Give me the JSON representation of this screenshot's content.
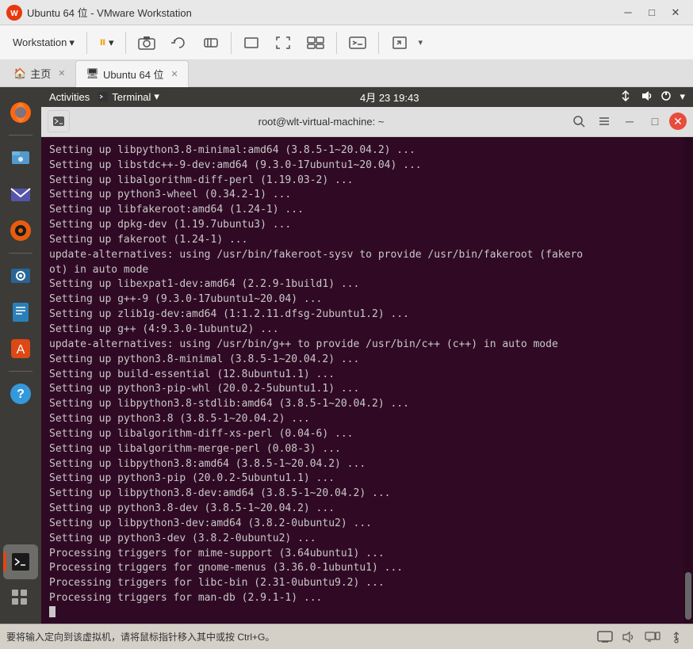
{
  "window": {
    "title": "Ubuntu 64 位 - VMware Workstation",
    "icon": "W"
  },
  "titlebar": {
    "minimize": "─",
    "restore": "□",
    "close": "✕"
  },
  "toolbar": {
    "workstation_label": "Workstation",
    "dropdown_arrow": "▾",
    "buttons": [
      {
        "name": "pause",
        "icon": "⏸",
        "has_dropdown": true
      },
      {
        "name": "snapshot",
        "icon": "📷"
      },
      {
        "name": "revert",
        "icon": "↺"
      },
      {
        "name": "suspend",
        "icon": "💤"
      },
      {
        "name": "power",
        "icon": "⏻"
      }
    ]
  },
  "tabs": [
    {
      "id": "home",
      "icon": "🏠",
      "label": "主页",
      "closable": true
    },
    {
      "id": "ubuntu",
      "icon": "🖥",
      "label": "Ubuntu 64 位",
      "closable": true,
      "active": true
    }
  ],
  "gnome_topbar": {
    "activities": "Activities",
    "app_name": "Terminal",
    "app_dropdown": "▾",
    "datetime": "4月 23  19:43",
    "net_icon": "⇅",
    "sound_icon": "🔊",
    "power_icon": "⏻",
    "dropdown": "▾"
  },
  "terminal": {
    "title": "root@wlt-virtual-machine: ~",
    "search_icon": "🔍",
    "menu_icon": "☰",
    "min_icon": "─",
    "restore_icon": "□",
    "close_icon": "✕",
    "content": [
      "Setting up libpython3.8-minimal:amd64 (3.8.5-1~20.04.2) ...",
      "Setting up libstdc++-9-dev:amd64 (9.3.0-17ubuntu1~20.04) ...",
      "Setting up libalgorithm-diff-perl (1.19.03-2) ...",
      "Setting up python3-wheel (0.34.2-1) ...",
      "Setting up libfakeroot:amd64 (1.24-1) ...",
      "Setting up dpkg-dev (1.19.7ubuntu3) ...",
      "Setting up fakeroot (1.24-1) ...",
      "update-alternatives: using /usr/bin/fakeroot-sysv to provide /usr/bin/fakeroot (fakero",
      "ot) in auto mode",
      "Setting up libexpat1-dev:amd64 (2.2.9-1build1) ...",
      "Setting up g++-9 (9.3.0-17ubuntu1~20.04) ...",
      "Setting up zlib1g-dev:amd64 (1:1.2.11.dfsg-2ubuntu1.2) ...",
      "Setting up g++ (4:9.3.0-1ubuntu2) ...",
      "update-alternatives: using /usr/bin/g++ to provide /usr/bin/c++ (c++) in auto mode",
      "Setting up python3.8-minimal (3.8.5-1~20.04.2) ...",
      "Setting up build-essential (12.8ubuntu1.1) ...",
      "Setting up python3-pip-whl (20.0.2-5ubuntu1.1) ...",
      "Setting up libpython3.8-stdlib:amd64 (3.8.5-1~20.04.2) ...",
      "Setting up python3.8 (3.8.5-1~20.04.2) ...",
      "Setting up libalgorithm-diff-xs-perl (0.04-6) ...",
      "Setting up libalgorithm-merge-perl (0.08-3) ...",
      "Setting up libpython3.8:amd64 (3.8.5-1~20.04.2) ...",
      "Setting up python3-pip (20.0.2-5ubuntu1.1) ...",
      "Setting up libpython3.8-dev:amd64 (3.8.5-1~20.04.2) ...",
      "Setting up python3.8-dev (3.8.5-1~20.04.2) ...",
      "Setting up libpython3-dev:amd64 (3.8.2-0ubuntu2) ...",
      "Setting up python3-dev (3.8.2-0ubuntu2) ...",
      "Processing triggers for mime-support (3.64ubuntu1) ...",
      "Processing triggers for gnome-menus (3.36.0-1ubuntu1) ...",
      "Processing triggers for libc-bin (2.31-0ubuntu9.2) ...",
      "Processing triggers for man-db (2.9.1-1) ..."
    ]
  },
  "status_bar": {
    "text": "要将输入定向到该虚拟机，请将鼠标指针移入其中或按 Ctrl+G。",
    "icons": [
      "🖥",
      "🔊",
      "📺",
      "⚡"
    ]
  },
  "sidebar_icons": [
    {
      "name": "firefox",
      "emoji": "🦊",
      "label": "Firefox"
    },
    {
      "name": "files",
      "emoji": "📁",
      "label": "Files"
    },
    {
      "name": "mail",
      "emoji": "✉️",
      "label": "Mail"
    },
    {
      "name": "rhythmbox",
      "emoji": "🎵",
      "label": "Rhythmbox"
    },
    {
      "name": "shotwell",
      "emoji": "🖼",
      "label": "Shotwell"
    },
    {
      "name": "libreoffice",
      "emoji": "📄",
      "label": "LibreOffice"
    },
    {
      "name": "appstore",
      "emoji": "🛍",
      "label": "App Store"
    },
    {
      "name": "help",
      "emoji": "❓",
      "label": "Help"
    },
    {
      "name": "terminal",
      "emoji": "⬛",
      "label": "Terminal"
    },
    {
      "name": "apps",
      "emoji": "⊞",
      "label": "Show Applications"
    }
  ]
}
